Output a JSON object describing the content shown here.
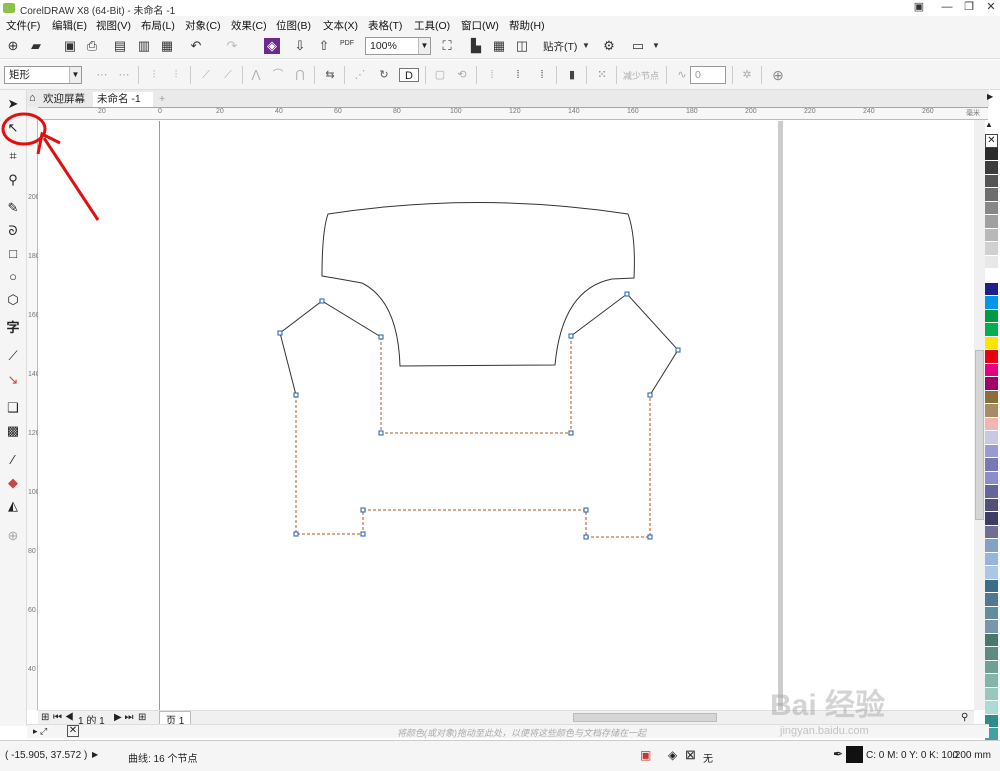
{
  "window": {
    "title": "CorelDRAW X8 (64-Bit) - 未命名 -1",
    "minimize": "—",
    "restore": "❐",
    "close": "✕"
  },
  "menu": [
    "文件(F)",
    "编辑(E)",
    "视图(V)",
    "布局(L)",
    "对象(C)",
    "效果(C)",
    "位图(B)",
    "文本(X)",
    "表格(T)",
    "工具(O)",
    "窗口(W)",
    "帮助(H)"
  ],
  "toolbar": {
    "zoom": "100%",
    "snap_label": "贴齐(T)",
    "pdf_label": "PDF"
  },
  "propbar": {
    "shape_select": "矩形",
    "reduce_nodes": "减少节点",
    "smooth_value": "0"
  },
  "tabs": {
    "welcome": "欢迎屏幕",
    "document": "未命名 -1",
    "add": "+"
  },
  "ruler": {
    "h_ticks": [
      "20",
      "0",
      "20",
      "40",
      "60",
      "80",
      "100",
      "120",
      "140",
      "160",
      "180",
      "200",
      "220",
      "240",
      "260"
    ],
    "unit": "毫米",
    "v_ticks": [
      "200",
      "180",
      "160",
      "140",
      "120",
      "100",
      "80",
      "60",
      "40"
    ]
  },
  "pagenav": {
    "of_label": "1 的 1",
    "page_tab": "页 1"
  },
  "colordock": {
    "hint": "将颜色(或对象)拖动至此处，以便将这些颜色与文档存储在一起"
  },
  "status": {
    "coords": "( -15.905, 37.572 )",
    "object_info": "曲线: 16 个节点",
    "fill_none": "无",
    "outline_cmyk": "C: 0 M: 0 Y: 0 K: 100",
    "outline_width": ".200 mm"
  },
  "palette": [
    "#ffffff",
    "#2b2b2b",
    "#3c3c3c",
    "#555555",
    "#6e6e6e",
    "#888888",
    "#a0a0a0",
    "#b8b8b8",
    "#d0d0d0",
    "#e8e8e8",
    "#ffffff",
    "#1e1e8c",
    "#0097e6",
    "#009a44",
    "#00b050",
    "#ffe600",
    "#e60012",
    "#e4007f",
    "#a0006e",
    "#8c6e3c",
    "#a88c64",
    "#f4b4b4",
    "#c8c8e6",
    "#9a9ad2",
    "#7878b4",
    "#8c8cc8",
    "#6464a0",
    "#505078",
    "#3c3c64",
    "#6e6e96",
    "#82a0c8",
    "#96b4dc",
    "#aac8e6",
    "#3c6e8c",
    "#507896",
    "#648ca0",
    "#7896aa",
    "#46786e",
    "#5a8c82",
    "#6ea096",
    "#82b4aa",
    "#96c8be",
    "#aadcd2",
    "#2e8c8c",
    "#46a0a0",
    "#5ab4b4"
  ],
  "watermark": {
    "brand": "Bai 经验",
    "url": "jingyan.baidu.com"
  }
}
